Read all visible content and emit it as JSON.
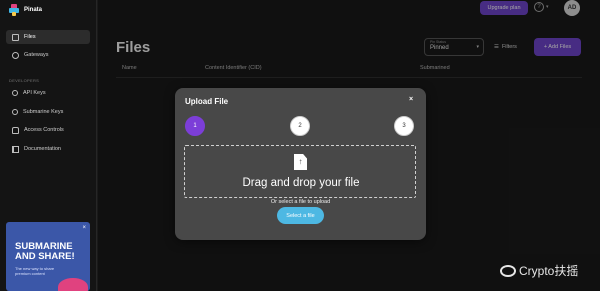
{
  "app": {
    "name": "Pinata"
  },
  "sidebar": {
    "items": [
      {
        "label": "Files",
        "icon": "folder-icon"
      },
      {
        "label": "Gateways",
        "icon": "globe-icon"
      }
    ],
    "developers_label": "DEVELOPERS",
    "dev_items": [
      {
        "label": "API Keys",
        "icon": "key-icon"
      },
      {
        "label": "Submarine Keys",
        "icon": "key-icon"
      },
      {
        "label": "Access Controls",
        "icon": "lock-icon"
      },
      {
        "label": "Documentation",
        "icon": "book-icon"
      }
    ],
    "promo": {
      "title_line1": "SUBMARINE",
      "title_line2": "AND SHARE!",
      "subtitle": "The new way to share premium content"
    }
  },
  "topbar": {
    "upgrade_label": "Upgrade plan",
    "avatar_initials": "AD"
  },
  "main": {
    "title": "Files",
    "pin_status_label": "Pin Status",
    "pin_status_value": "Pinned",
    "filters_label": "Filters",
    "add_files_label": "+ Add Files",
    "columns": [
      "Name",
      "Content Identifier (CID)",
      "Submarined"
    ]
  },
  "modal": {
    "title": "Upload File",
    "close": "×",
    "steps": [
      "1",
      "2",
      "3"
    ],
    "active_step": 1,
    "drop_text": "Drag and drop your file",
    "or_text": "Or select a file to upload",
    "select_button": "Select a file"
  },
  "watermark": {
    "text": "Crypto扶摇"
  }
}
